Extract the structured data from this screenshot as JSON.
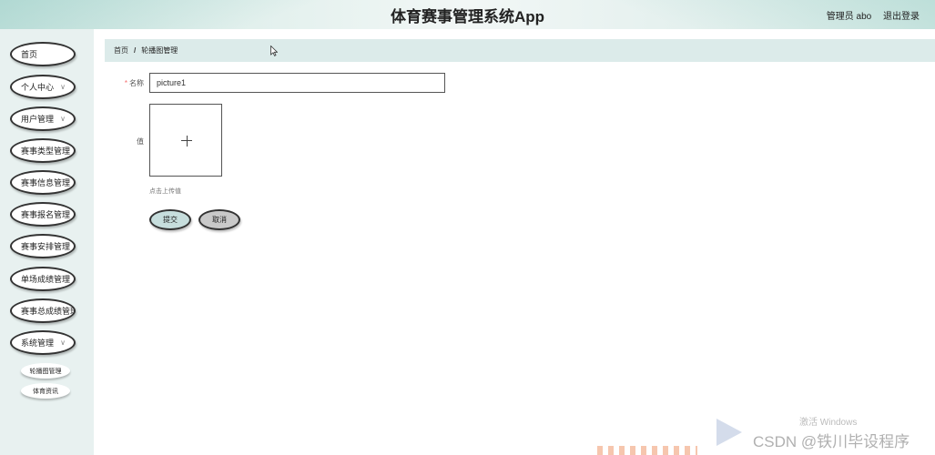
{
  "header": {
    "title": "体育赛事管理系统App",
    "user_label": "管理员 abo",
    "logout_label": "退出登录"
  },
  "sidebar": {
    "items": [
      {
        "label": "首页",
        "has_submenu": false
      },
      {
        "label": "个人中心",
        "has_submenu": true
      },
      {
        "label": "用户管理",
        "has_submenu": true
      },
      {
        "label": "赛事类型管理",
        "has_submenu": false
      },
      {
        "label": "赛事信息管理",
        "has_submenu": false
      },
      {
        "label": "赛事报名管理",
        "has_submenu": false
      },
      {
        "label": "赛事安排管理",
        "has_submenu": false
      },
      {
        "label": "单场成绩管理",
        "has_submenu": false
      },
      {
        "label": "赛事总成绩管理",
        "has_submenu": false
      },
      {
        "label": "系统管理",
        "has_submenu": true
      }
    ],
    "subitems": [
      {
        "label": "轮播图管理"
      },
      {
        "label": "体育资讯"
      }
    ]
  },
  "breadcrumb": {
    "home": "首页",
    "separator": "/",
    "current": "轮播图管理"
  },
  "form": {
    "name_label": "名称",
    "name_required_mark": "*",
    "name_value": "picture1",
    "value_label": "值",
    "upload_hint": "点击上传值",
    "submit_label": "提交",
    "cancel_label": "取消"
  },
  "watermark": {
    "windows_text": "激活 Windows",
    "csdn_text": "CSDN @铁川毕设程序"
  },
  "colors": {
    "header_bg": "#d8ece8",
    "sidebar_bg": "#e8f1f0",
    "breadcrumb_bg": "#dcebea",
    "submit_bg": "#c7dedd",
    "cancel_bg": "#c9c9c9",
    "required": "#f56c6c"
  }
}
